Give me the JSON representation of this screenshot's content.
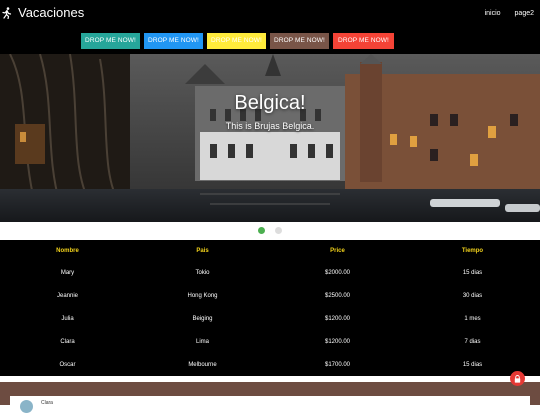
{
  "navbar": {
    "brand_icon": "running-person-icon",
    "title": "Vacaciones",
    "links": [
      "inicio",
      "page2"
    ]
  },
  "buttons": [
    {
      "label": "DROP ME NOW!",
      "color": "#26a69a",
      "text_color": "#ffffff"
    },
    {
      "label": "DROP ME NOW!",
      "color": "#2196f3",
      "text_color": "#ffffff"
    },
    {
      "label": "DROP ME NOW!",
      "color": "#ffeb3b",
      "text_color": "#ffffff"
    },
    {
      "label": "DROP ME NOW!",
      "color": "#795548",
      "text_color": "#ffffff"
    },
    {
      "label": "DROP ME NOW!",
      "color": "#f44336",
      "text_color": "#ffffff"
    }
  ],
  "slider": {
    "title": "Belgica!",
    "subtitle": "This is Brujas Belgica.",
    "indicators": [
      {
        "state": "active",
        "color": "#4caf50"
      },
      {
        "state": "inactive",
        "color": "#dddddd"
      }
    ]
  },
  "table": {
    "headers": [
      "Nombre",
      "Pais",
      "Price",
      "Tiempo"
    ],
    "rows": [
      [
        "Mary",
        "Tokio",
        "$2000.00",
        "15 dias"
      ],
      [
        "Jeannie",
        "Hong Kong",
        "$2500.00",
        "30 dias"
      ],
      [
        "Julia",
        "Beiging",
        "$1200.00",
        "1 mes"
      ],
      [
        "Clara",
        "Lima",
        "$1200.00",
        "7 dias"
      ],
      [
        "Oscar",
        "Melbourne",
        "$1700.00",
        "15 dias"
      ]
    ]
  },
  "fab": {
    "icon": "lock-icon",
    "color": "#e53935"
  },
  "comments": {
    "first_author": "Clara"
  }
}
